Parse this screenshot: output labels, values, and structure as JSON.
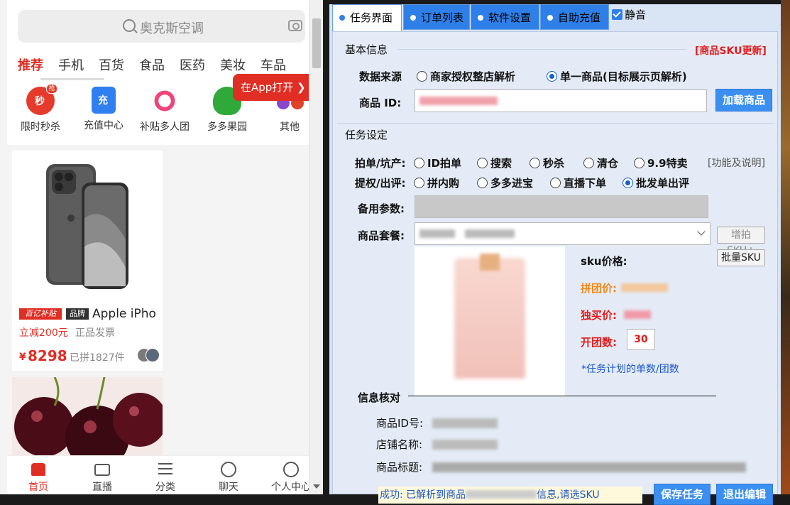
{
  "phone": {
    "search_placeholder": "奥克斯空调",
    "categories": [
      "推荐",
      "手机",
      "百货",
      "食品",
      "医药",
      "美妆",
      "车品"
    ],
    "open_app": "在App打开",
    "open_app_arrow": "❯",
    "quick_icons": [
      {
        "label": "限时秒杀",
        "glyph": "秒",
        "badge": "抢",
        "color": "#e53a2c"
      },
      {
        "label": "充值中心",
        "glyph": "充",
        "color": "#2f7ff0"
      },
      {
        "label": "补贴多人团",
        "glyph": "",
        "color": "#f0447a"
      },
      {
        "label": "多多果园",
        "glyph": "",
        "color": "#2faa3a"
      },
      {
        "label": "其他",
        "glyph": "",
        "color": "#8a47d0"
      }
    ],
    "product": {
      "badge_subsidy": "百亿补贴",
      "badge_brand": "品牌",
      "title": "Apple iPho",
      "promo": "立减200元",
      "invoice": "正品发票",
      "currency": "¥",
      "price": "8298",
      "sold": "已拼1827件"
    },
    "nav": [
      {
        "label": "首页",
        "icon": "home-icon",
        "active": true
      },
      {
        "label": "直播",
        "icon": "tv-icon",
        "active": false
      },
      {
        "label": "分类",
        "icon": "list-icon",
        "active": false
      },
      {
        "label": "聊天",
        "icon": "chat-icon",
        "active": false
      },
      {
        "label": "个人中心",
        "icon": "user-icon",
        "active": false
      }
    ]
  },
  "tool": {
    "tabs": [
      "任务界面",
      "订单列表",
      "软件设置",
      "自助充值"
    ],
    "mute_label": "静音",
    "basic_info_title": "基本信息",
    "sku_update": "[商品SKU更新]",
    "data_source_label": "数据来源",
    "data_source_options": [
      "商家授权整店解析",
      "单一商品(目标展示页解析)"
    ],
    "data_source_selected": 1,
    "product_id_label": "商品 ID:",
    "load_button": "加载商品",
    "task_settings_title": "任务设定",
    "order_mode_label": "拍单/坑产:",
    "order_mode_options": [
      "ID拍单",
      "搜索",
      "秒杀",
      "清仓",
      "9.9特卖"
    ],
    "features_link": "[功能及说明]",
    "withdraw_label": "提权/出评:",
    "withdraw_options": [
      "拼内购",
      "多多进宝",
      "直播下单",
      "批发单出评"
    ],
    "withdraw_selected": 3,
    "backup_label": "备用参数:",
    "package_label": "商品套餐:",
    "add_sku_button": "增拍SKU+",
    "batch_sku_button": "批量SKU",
    "sku_price_label": "sku价格:",
    "group_price_label": "拼团价:",
    "single_price_label": "独买价:",
    "groups_label": "开团数:",
    "groups_value": "30",
    "groups_note": "*任务计划的单数/团数",
    "verify_title": "信息核对",
    "verify_fields": [
      "商品ID号:",
      "店铺名称:",
      "商品标题:"
    ],
    "status_prefix": "成功: 已解析到商品",
    "status_suffix": "信息,请选SKU",
    "save_button": "保存任务",
    "exit_button": "退出编辑"
  },
  "colors": {
    "brand_red": "#e02e24",
    "tool_blue": "#2f7fe8",
    "orange_price": "#ef8a1a",
    "red_price": "#e21b1b"
  }
}
